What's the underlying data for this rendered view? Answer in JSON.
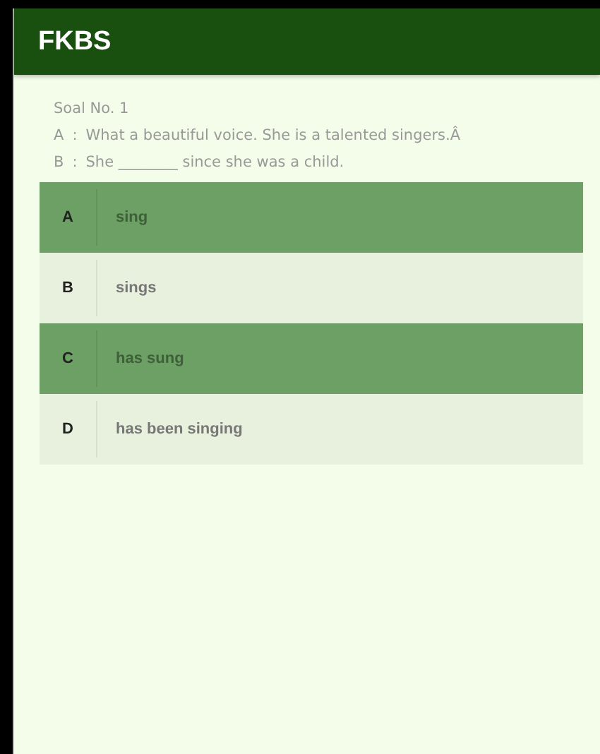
{
  "app_bar": {
    "title": "FKBS"
  },
  "question": {
    "number": "Soal No. 1",
    "lines": [
      {
        "speaker": "A",
        "sep": ":",
        "text": "What a beautiful voice. She is a talented singers.Â"
      },
      {
        "speaker": "B",
        "sep": ":",
        "text": "She ________ since she was a child."
      }
    ]
  },
  "options": [
    {
      "letter": "A",
      "text": "sing",
      "selected": true
    },
    {
      "letter": "B",
      "text": "sings",
      "selected": false
    },
    {
      "letter": "C",
      "text": "has sung",
      "selected": true
    },
    {
      "letter": "D",
      "text": "has been singing",
      "selected": false
    }
  ]
}
